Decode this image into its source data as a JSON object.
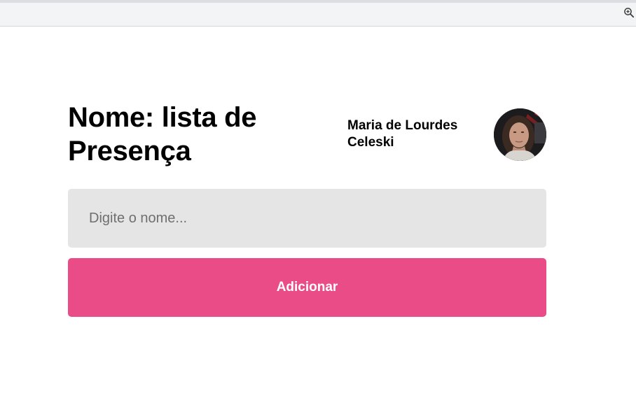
{
  "browser": {
    "toolbar_icon": "zoom-in-icon"
  },
  "header": {
    "title": "Nome: lista de Presença",
    "user_name": "Maria de Lourdes Celeski",
    "avatar_icon": "avatar-photo"
  },
  "form": {
    "name_placeholder": "Digite o nome...",
    "name_value": "",
    "add_label": "Adicionar"
  },
  "colors": {
    "accent": "#e94c86",
    "input_bg": "#e5e5e5",
    "text": "#000000",
    "placeholder": "#6f6f6f"
  }
}
